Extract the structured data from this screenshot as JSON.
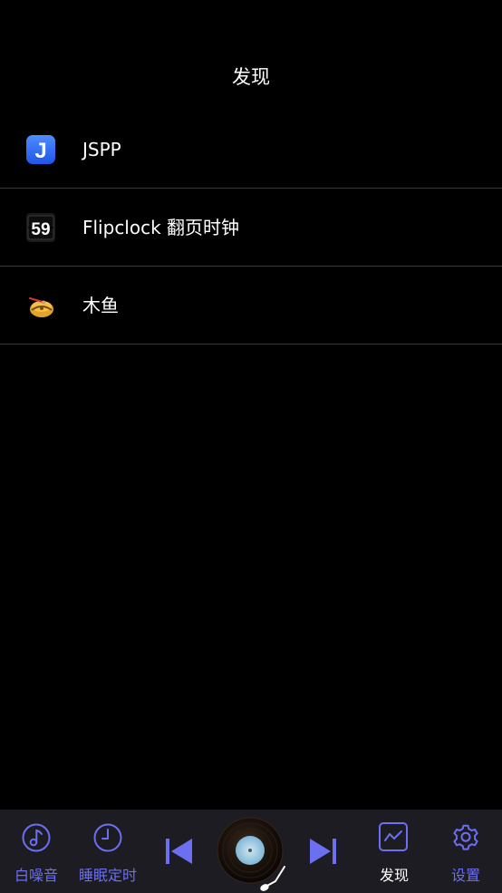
{
  "header": {
    "title": "发现"
  },
  "list": {
    "items": [
      {
        "label": "JSPP",
        "icon": "jspp-app-icon",
        "icon_text": "J"
      },
      {
        "label": "Flipclock 翻页时钟",
        "icon": "flipclock-app-icon",
        "icon_text": "59"
      },
      {
        "label": "木鱼",
        "icon": "wooden-fish-app-icon"
      }
    ]
  },
  "tabbar": {
    "white_noise": {
      "label": "白噪音",
      "icon": "music-note-icon"
    },
    "sleep_timer": {
      "label": "睡眠定时",
      "icon": "clock-icon"
    },
    "previous": {
      "icon": "skip-previous-icon"
    },
    "record": {
      "icon": "vinyl-record-icon"
    },
    "next": {
      "icon": "skip-next-icon"
    },
    "discover": {
      "label": "发现",
      "icon": "chart-icon"
    },
    "settings": {
      "label": "设置",
      "icon": "gear-icon"
    }
  },
  "colors": {
    "background": "#000000",
    "tabbar_background": "#1c1c22",
    "accent": "#6b6ff0",
    "active_label": "#ffffff",
    "divider": "#3a3a3c",
    "jspp_blue": "#2f6ff6"
  }
}
